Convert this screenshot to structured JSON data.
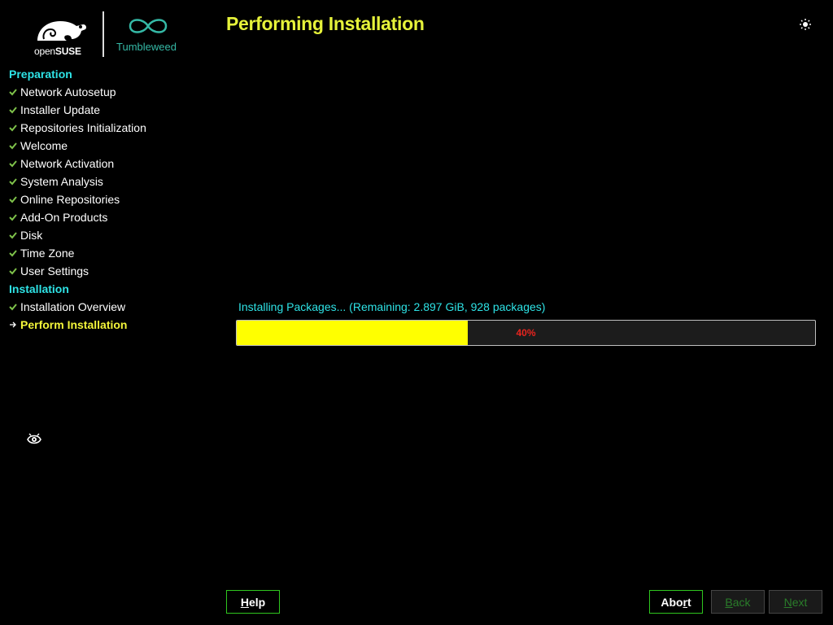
{
  "branding": {
    "suse_word_prefix": "open",
    "suse_word_bold": "SUSE",
    "product": "Tumbleweed"
  },
  "title": "Performing Installation",
  "sidebar": {
    "sections": [
      {
        "title": "Preparation",
        "steps": [
          {
            "label": "Network Autosetup",
            "status": "done"
          },
          {
            "label": "Installer Update",
            "status": "done"
          },
          {
            "label": "Repositories Initialization",
            "status": "done"
          },
          {
            "label": "Welcome",
            "status": "done"
          },
          {
            "label": "Network Activation",
            "status": "done"
          },
          {
            "label": "System Analysis",
            "status": "done"
          },
          {
            "label": "Online Repositories",
            "status": "done"
          },
          {
            "label": "Add-On Products",
            "status": "done"
          },
          {
            "label": "Disk",
            "status": "done"
          },
          {
            "label": "Time Zone",
            "status": "done"
          },
          {
            "label": "User Settings",
            "status": "done"
          }
        ]
      },
      {
        "title": "Installation",
        "steps": [
          {
            "label": "Installation Overview",
            "status": "done"
          },
          {
            "label": "Perform Installation",
            "status": "current"
          }
        ]
      }
    ]
  },
  "progress": {
    "label": "Installing Packages... (Remaining: 2.897 GiB, 928 packages)",
    "percent": 40,
    "percent_text": "40%"
  },
  "buttons": {
    "help": {
      "accel": "H",
      "rest": "elp"
    },
    "abort": {
      "pre": "Abo",
      "accel": "r",
      "rest": "t"
    },
    "back": {
      "accel": "B",
      "rest": "ack"
    },
    "next": {
      "accel": "N",
      "rest": "ext"
    }
  },
  "colors": {
    "title": "#e6f23a",
    "section": "#2ee3e6",
    "check": "#7ec24a",
    "progress_fill": "#ffff00",
    "progress_text": "#e8241e",
    "button_border": "#2fc61f"
  },
  "icons": {
    "theme_toggle": "sun-icon",
    "done_step": "check-icon",
    "current_step": "arrow-right-icon",
    "accessibility": "accessibility-icon"
  }
}
